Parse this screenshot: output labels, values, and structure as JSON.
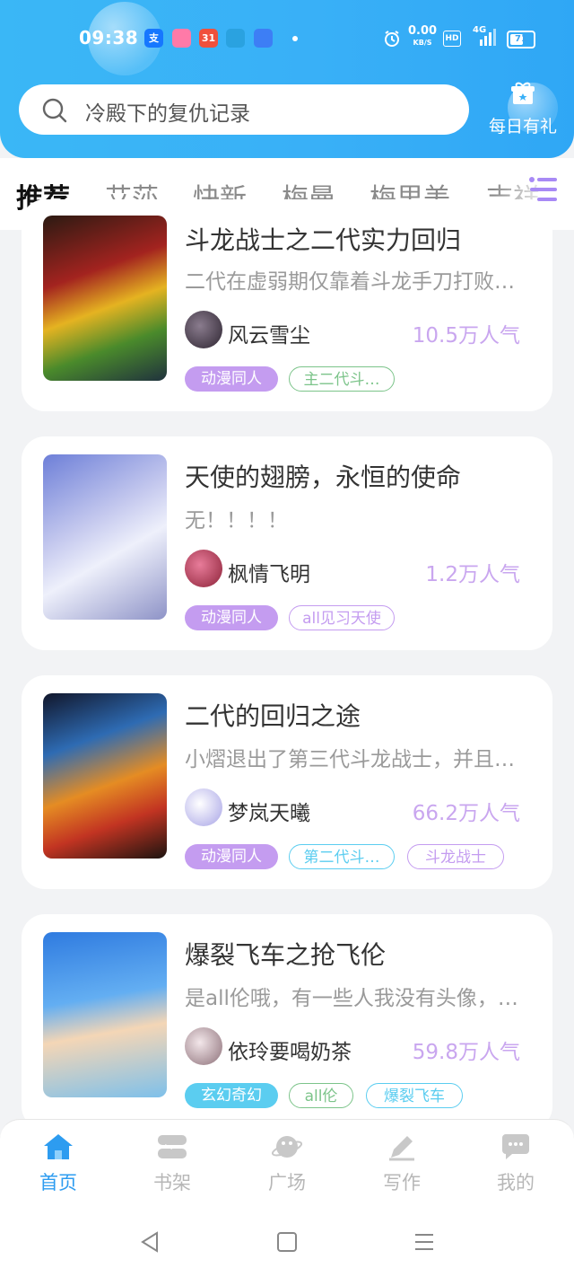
{
  "status_bar": {
    "time": "09:38",
    "app_icons": [
      "支",
      "",
      "31",
      "",
      ""
    ],
    "net_speed": "0.00",
    "net_unit": "KB/S",
    "hd": "HD",
    "network_type": "4G",
    "battery": "71",
    "battery_level": 0.71
  },
  "search": {
    "text": "冷殿下的复仇记录",
    "icon": "search-icon"
  },
  "gift": {
    "label": "每日有礼",
    "icon": "gift-icon"
  },
  "tabs": [
    {
      "label": "推荐",
      "active": true
    },
    {
      "label": "艾莎"
    },
    {
      "label": "快新"
    },
    {
      "label": "梅曼"
    },
    {
      "label": "梅里美"
    },
    {
      "label": "吉祥"
    }
  ],
  "colors": {
    "header_blue": "#39b0f7",
    "accent_purple": "#c09cf0",
    "tag_purple": "#c49cf0",
    "tag_cyan": "#5bcdf0",
    "tag_green": "#7cc48a",
    "active_blue": "#2d9cf0"
  },
  "books": [
    {
      "title": "斗龙战士之二代实力回归",
      "desc": "二代在虚弱期仅靠着斗龙手刀打败…",
      "author": "风云雪尘",
      "popularity": "10.5万人气",
      "tags": [
        {
          "text": "动漫同人",
          "style": "filled-purple"
        },
        {
          "text": "主二代斗…",
          "style": "outline-green"
        }
      ]
    },
    {
      "title": "天使的翅膀，永恒的使命",
      "desc": "无！！！！",
      "author": "枫情飞明",
      "popularity": "1.2万人气",
      "tags": [
        {
          "text": "动漫同人",
          "style": "filled-purple"
        },
        {
          "text": "all见习天使",
          "style": "outline-purple"
        }
      ]
    },
    {
      "title": "二代的回归之途",
      "desc": "小熠退出了第三代斗龙战士，并且…",
      "author": "梦岚天曦",
      "popularity": "66.2万人气",
      "tags": [
        {
          "text": "动漫同人",
          "style": "filled-purple"
        },
        {
          "text": "第二代斗…",
          "style": "outline-cyan"
        },
        {
          "text": "斗龙战士",
          "style": "outline-purple"
        }
      ]
    },
    {
      "title": "爆裂飞车之抢飞伦",
      "desc": "是all伦哦，有一些人我没有头像，…",
      "author": "依玲要喝奶茶",
      "popularity": "59.8万人气",
      "tags": [
        {
          "text": "玄幻奇幻",
          "style": "filled-cyan"
        },
        {
          "text": "all伦",
          "style": "outline-green"
        },
        {
          "text": "爆裂飞车",
          "style": "outline-cyan"
        }
      ]
    }
  ],
  "bottom_nav": [
    {
      "label": "首页",
      "icon": "home-icon",
      "active": true
    },
    {
      "label": "书架",
      "icon": "bookshelf-icon"
    },
    {
      "label": "广场",
      "icon": "planet-icon"
    },
    {
      "label": "写作",
      "icon": "pen-icon"
    },
    {
      "label": "我的",
      "icon": "chat-icon"
    }
  ],
  "system_nav": [
    "back-icon",
    "home-square-icon",
    "recents-icon"
  ]
}
